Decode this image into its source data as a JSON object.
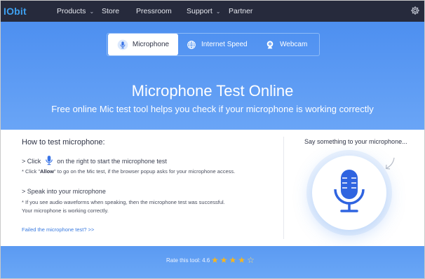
{
  "header": {
    "logo": "IObit",
    "nav": [
      {
        "label": "Products",
        "has_dropdown": true
      },
      {
        "label": "Store",
        "has_dropdown": false
      },
      {
        "label": "Pressroom",
        "has_dropdown": false
      },
      {
        "label": "Support",
        "has_dropdown": true
      },
      {
        "label": "Partner",
        "has_dropdown": false
      }
    ],
    "settings_icon": "gear-icon"
  },
  "tabs": [
    {
      "label": "Microphone",
      "icon": "microphone-icon",
      "active": true
    },
    {
      "label": "Internet Speed",
      "icon": "globe-icon",
      "active": false
    },
    {
      "label": "Webcam",
      "icon": "webcam-icon",
      "active": false
    }
  ],
  "hero": {
    "title": "Microphone Test Online",
    "subtitle": "Free online Mic test tool helps you check if your microphone is working correctly"
  },
  "instructions": {
    "title": "How to test microphone:",
    "step1_prefix": "> Click",
    "step1_suffix": "on the right to start the microphone test",
    "step1_note_prefix": "* Click \"",
    "step1_note_bold": "Allow",
    "step1_note_suffix": "\" to go on the Mic test, if the browser popup asks for your microphone access.",
    "step2": "> Speak into your microphone",
    "step2_note1": "* If you see audio waveforms when speaking, then the microphone test was successful.",
    "step2_note2": "Your microphone is working correctly.",
    "fail_link": "Failed the microphone test? >>"
  },
  "tester": {
    "prompt": "Say something to your microphone...",
    "button_icon": "microphone-icon"
  },
  "footer": {
    "rating_label": "Rate this tool: 4.6",
    "rating_value": 4.6,
    "rating_max": 5
  },
  "colors": {
    "topbar": "#262a3c",
    "accent": "#4d8ff0",
    "mic_blue": "#2f64e0",
    "star": "#f6b51f"
  }
}
